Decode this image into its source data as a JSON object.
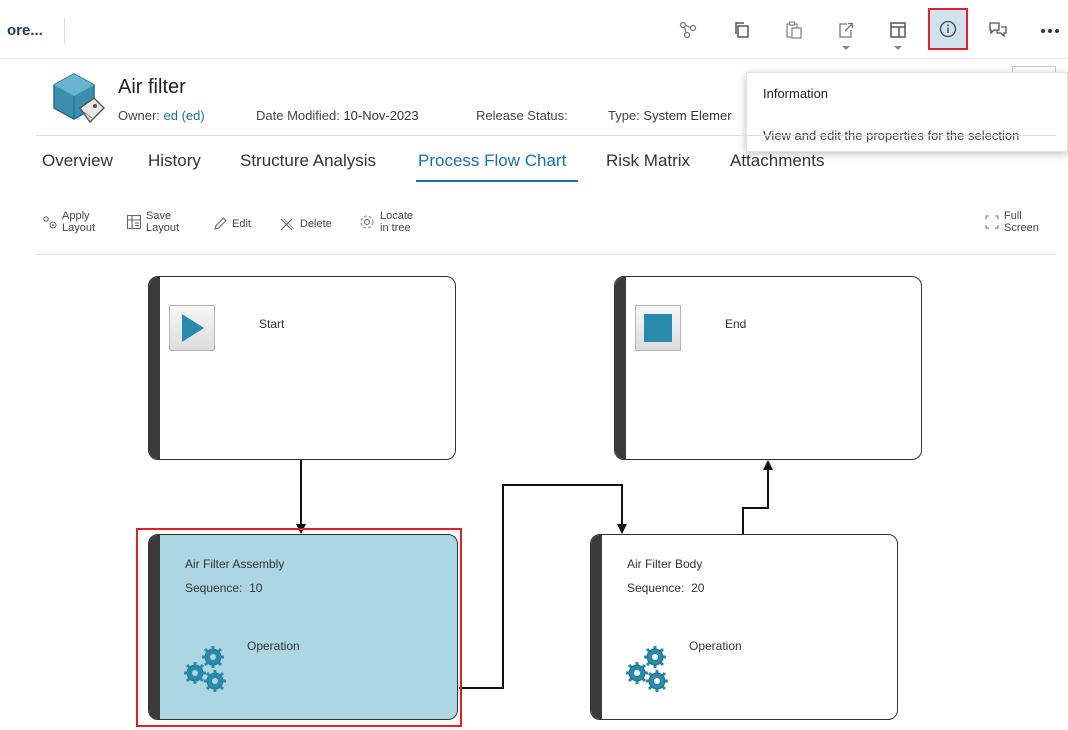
{
  "topbar": {
    "more_label": "ore...",
    "icons": [
      "tree-icon",
      "copy-icon",
      "paste-icon",
      "export-icon",
      "layout-icon",
      "info-icon",
      "comments-icon",
      "more-icon"
    ]
  },
  "header": {
    "title": "Air filter",
    "owner_label": "Owner:",
    "owner_value": "ed (ed)",
    "date_label": "Date Modified:",
    "date_value": "10-Nov-2023",
    "release_label": "Release Status:",
    "type_label": "Type:",
    "type_value": "System Elemer"
  },
  "tooltip": {
    "title": "Information",
    "body": "View and edit the properties for the selection"
  },
  "tabs": [
    {
      "label": "Overview"
    },
    {
      "label": "History"
    },
    {
      "label": "Structure Analysis"
    },
    {
      "label": "Process Flow Chart",
      "active": true
    },
    {
      "label": "Risk Matrix"
    },
    {
      "label": "Attachments"
    }
  ],
  "chart_toolbar": {
    "apply_layout": [
      "Apply",
      "Layout"
    ],
    "save_layout": [
      "Save",
      "Layout"
    ],
    "edit": "Edit",
    "delete": "Delete",
    "locate": [
      "Locate",
      "in tree"
    ],
    "full_screen": [
      "Full",
      "Screen"
    ]
  },
  "nodes": {
    "start": {
      "label": "Start"
    },
    "end": {
      "label": "End"
    },
    "assembly": {
      "name": "Air Filter Assembly",
      "sequence_label": "Sequence:",
      "sequence": "10",
      "type": "Operation"
    },
    "body": {
      "name": "Air Filter Body",
      "sequence_label": "Sequence:",
      "sequence": "20",
      "type": "Operation"
    }
  },
  "colors": {
    "accent": "#1a6ea8",
    "selection_fill": "#acd6e2",
    "highlight_red": "#e0202a",
    "icon_teal": "#2a8aab"
  }
}
